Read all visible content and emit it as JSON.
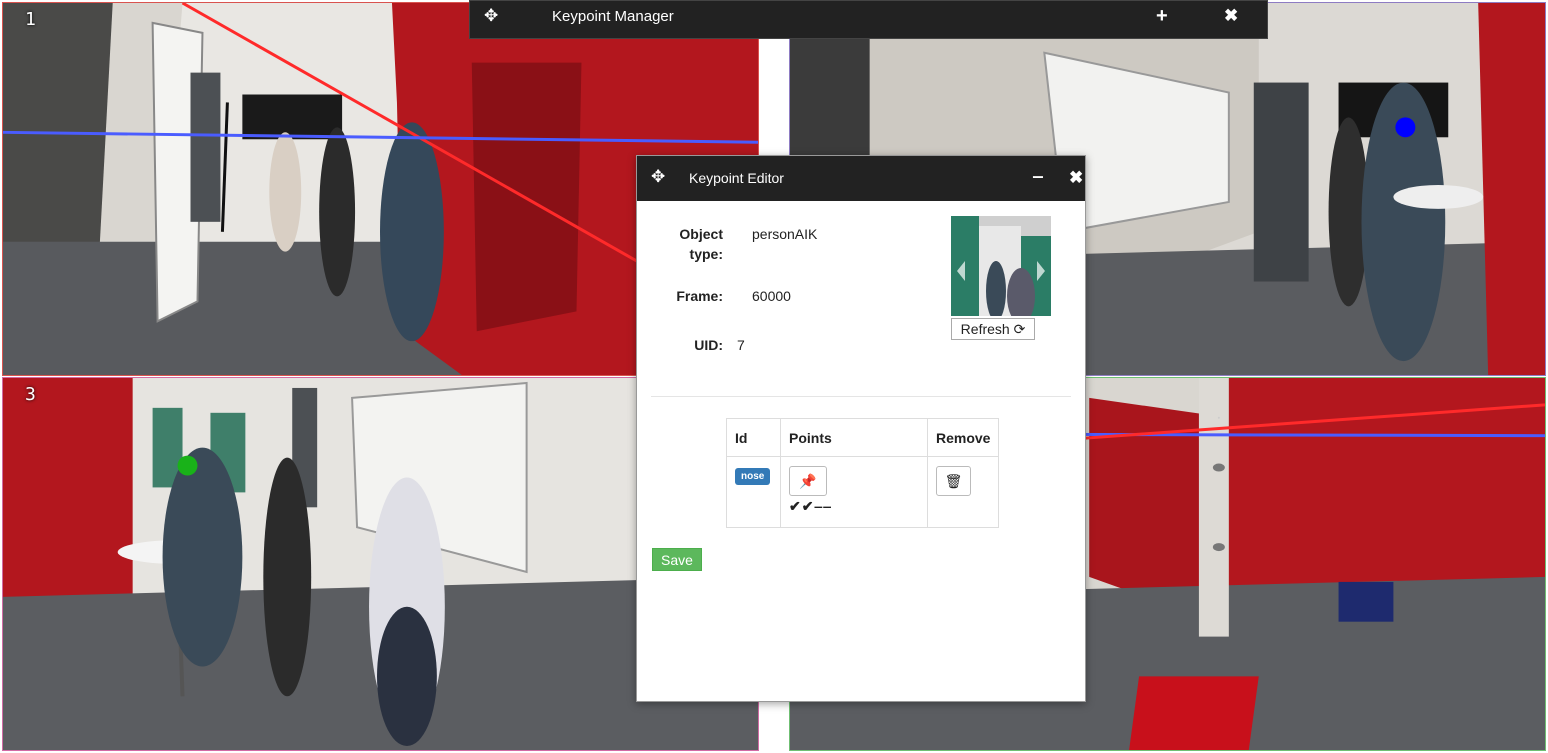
{
  "views": [
    {
      "number": "1"
    },
    {
      "number": ""
    },
    {
      "number": "3"
    },
    {
      "number": ""
    }
  ],
  "keypoint_manager": {
    "title": "Keypoint Manager",
    "move_icon": "move-icon",
    "add_icon": "plus-icon",
    "close_icon": "close-icon"
  },
  "keypoint_editor": {
    "title": "Keypoint Editor",
    "object_type_label": "Object type:",
    "object_type_value": "personAIK",
    "frame_label": "Frame:",
    "frame_value": "60000",
    "uid_label": "UID:",
    "uid_value": "7",
    "refresh_label": "Refresh",
    "table": {
      "headers": [
        "Id",
        "Points",
        "Remove"
      ],
      "rows": [
        {
          "id": "nose",
          "points_status": "✔✔‒‒"
        }
      ]
    },
    "save_label": "Save"
  },
  "colors": {
    "header_bg": "#222222",
    "badge": "#337ab7",
    "save": "#5cb85c",
    "wall_red": "#b5121b",
    "epipolar_red": "#ff2a2a",
    "epipolar_blue": "#4a5cff",
    "keypoint_blue": "#0000ff",
    "keypoint_green": "#19b219"
  }
}
